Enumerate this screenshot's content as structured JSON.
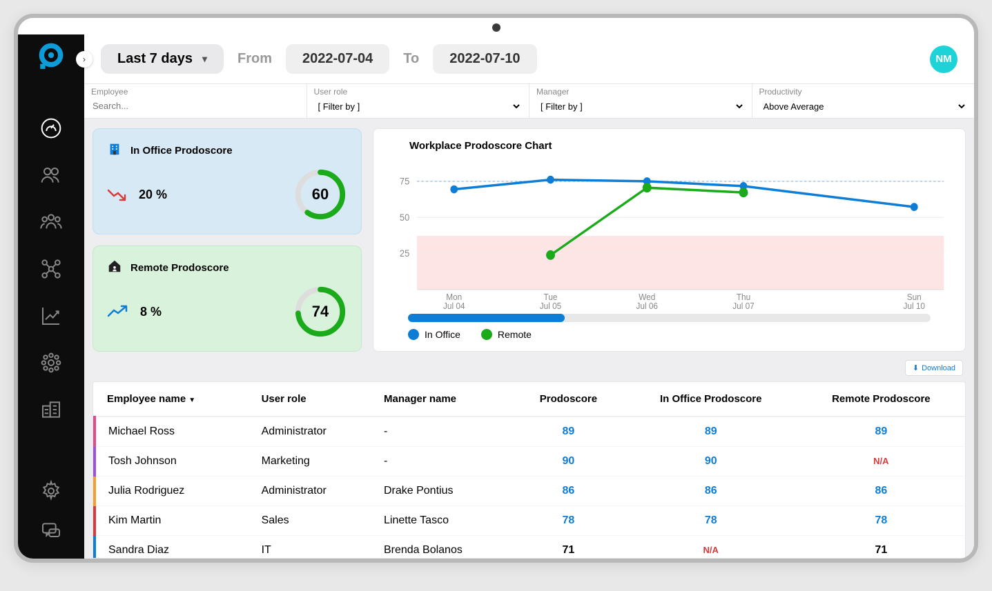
{
  "header": {
    "range_label": "Last 7 days",
    "from_label": "From",
    "from_date": "2022-07-04",
    "to_label": "To",
    "to_date": "2022-07-10",
    "avatar_initials": "NM"
  },
  "filters": {
    "employee": {
      "label": "Employee",
      "placeholder": "Search..."
    },
    "user_role": {
      "label": "User role",
      "placeholder": "[ Filter by ]"
    },
    "manager": {
      "label": "Manager",
      "placeholder": "[ Filter by ]"
    },
    "productivity": {
      "label": "Productivity",
      "value": "Above Average"
    }
  },
  "cards": {
    "office": {
      "title": "In Office Prodoscore",
      "trend_pct": "20 %",
      "score": "60"
    },
    "remote": {
      "title": "Remote Prodoscore",
      "trend_pct": "8 %",
      "score": "74"
    }
  },
  "chart": {
    "title": "Workplace Prodoscore Chart",
    "legend_office": "In Office",
    "legend_remote": "Remote"
  },
  "chart_data": {
    "type": "line",
    "categories": [
      "Mon Jul 04",
      "Tue Jul 05",
      "Wed Jul 06",
      "Thu Jul 07",
      "Sun Jul 10"
    ],
    "y_ticks": [
      25,
      50,
      75
    ],
    "ylim": [
      0,
      90
    ],
    "series": [
      {
        "name": "In Office",
        "color": "#0d7dd6",
        "values": [
          70,
          77,
          76,
          72,
          58
        ]
      },
      {
        "name": "Remote",
        "color": "#1aaa1a",
        "values": [
          null,
          24,
          70,
          67,
          null
        ]
      }
    ],
    "threshold_band": {
      "low": 0,
      "high": 42,
      "mid_line": 75
    }
  },
  "download_label": "Download",
  "table": {
    "headers": {
      "name": "Employee name",
      "role": "User role",
      "manager": "Manager name",
      "score": "Prodoscore",
      "office": "In Office Prodoscore",
      "remote": "Remote Prodoscore"
    },
    "rows": [
      {
        "color": "#e24a8b",
        "name": "Michael Ross",
        "role": "Administrator",
        "manager": "-",
        "score": "89",
        "office": "89",
        "remote": "89"
      },
      {
        "color": "#9a53d8",
        "name": "Tosh Johnson",
        "role": "Marketing",
        "manager": "-",
        "score": "90",
        "office": "90",
        "remote": "N/A"
      },
      {
        "color": "#f0a030",
        "name": "Julia Rodriguez",
        "role": "Administrator",
        "manager": "Drake Pontius",
        "score": "86",
        "office": "86",
        "remote": "86"
      },
      {
        "color": "#d93a3a",
        "name": "Kim Martin",
        "role": "Sales",
        "manager": "Linette Tasco",
        "score": "78",
        "office": "78",
        "remote": "78"
      },
      {
        "color": "#0d7dd6",
        "name": "Sandra Diaz",
        "role": "IT",
        "manager": "Brenda Bolanos",
        "score": "71",
        "office": "N/A",
        "remote": "71"
      }
    ]
  },
  "x_labels": {
    "l0a": "Mon",
    "l0b": "Jul 04",
    "l1a": "Tue",
    "l1b": "Jul 05",
    "l2a": "Wed",
    "l2b": "Jul 06",
    "l3a": "Thu",
    "l3b": "Jul 07",
    "l4a": "Sun",
    "l4b": "Jul 10"
  },
  "y_labels": {
    "y0": "25",
    "y1": "50",
    "y2": "75"
  }
}
